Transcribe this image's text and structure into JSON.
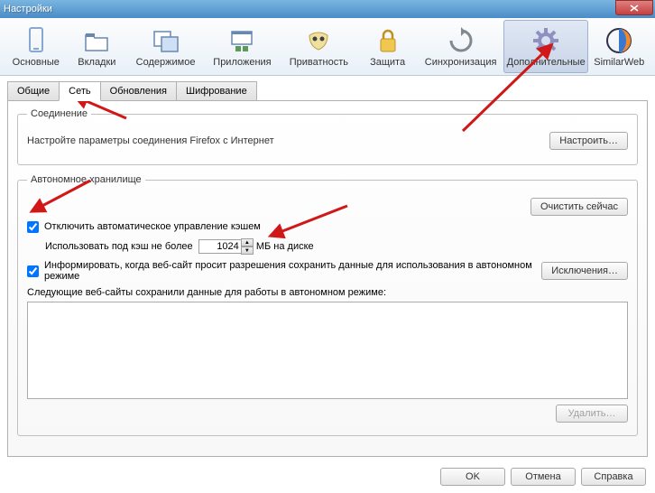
{
  "window": {
    "title": "Настройки"
  },
  "toolbar": {
    "items": [
      {
        "label": "Основные"
      },
      {
        "label": "Вкладки"
      },
      {
        "label": "Содержимое"
      },
      {
        "label": "Приложения"
      },
      {
        "label": "Приватность"
      },
      {
        "label": "Защита"
      },
      {
        "label": "Синхронизация"
      },
      {
        "label": "Дополнительные"
      },
      {
        "label": "SimilarWeb"
      }
    ]
  },
  "tabs": {
    "items": [
      {
        "label": "Общие"
      },
      {
        "label": "Сеть"
      },
      {
        "label": "Обновления"
      },
      {
        "label": "Шифрование"
      }
    ],
    "active_index": 1
  },
  "connection": {
    "legend": "Соединение",
    "desc": "Настройте параметры соединения Firefox с Интернет",
    "configure_button": "Настроить…"
  },
  "offline": {
    "legend": "Автономное хранилище",
    "clear_button": "Очистить сейчас",
    "auto_cache_checkbox": "Отключить автоматическое управление кэшем",
    "auto_cache_checked": true,
    "cache_label_prefix": "Использовать под кэш не более",
    "cache_value": "1024",
    "cache_label_suffix": "МБ на диске",
    "inform_checkbox": "Информировать, когда веб-сайт просит разрешения сохранить данные для использования в автономном режиме",
    "inform_checked": true,
    "exceptions_button": "Исключения…",
    "sites_label": "Следующие веб-сайты сохранили данные для работы в автономном режиме:",
    "delete_button": "Удалить…"
  },
  "footer": {
    "ok": "OK",
    "cancel": "Отмена",
    "help": "Справка"
  },
  "colors": {
    "arrow": "#d01818"
  }
}
